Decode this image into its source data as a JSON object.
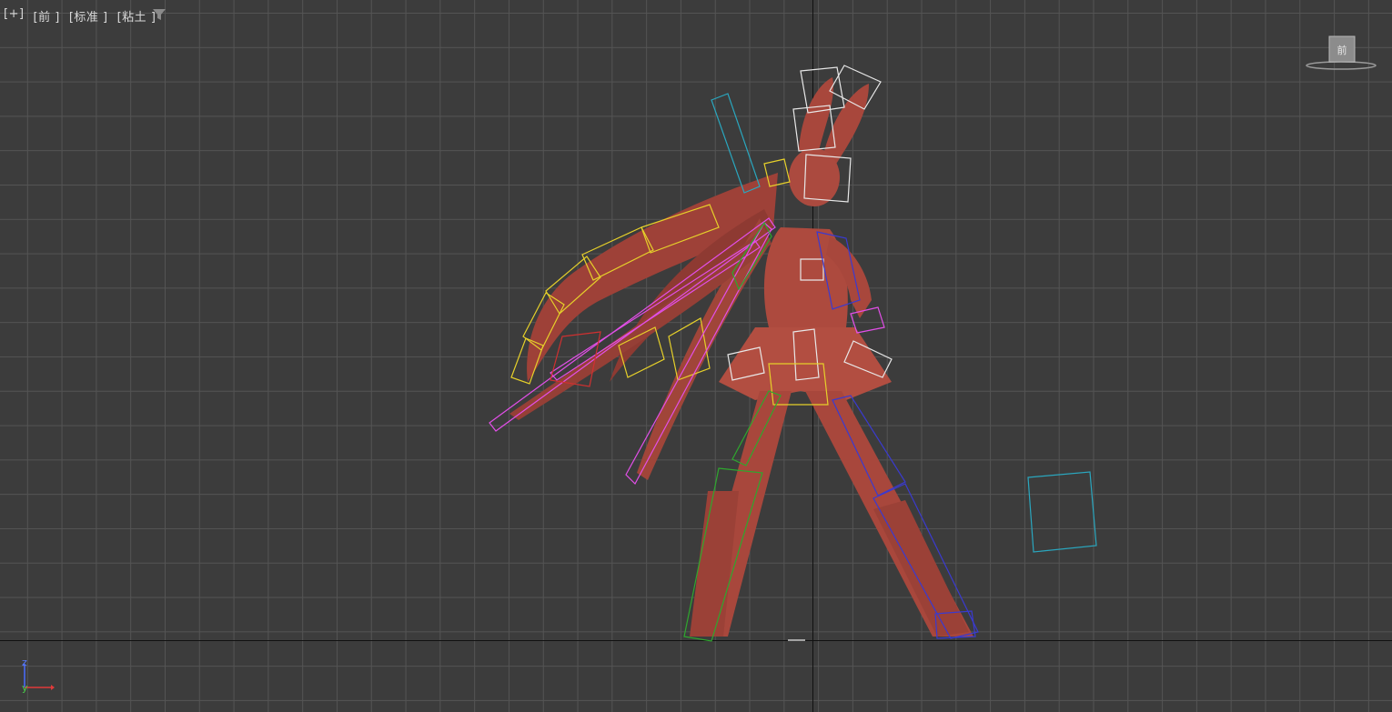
{
  "viewport": {
    "labels": [
      "[+]",
      "[前 ]",
      "[标准 ]",
      "[粘土 ]"
    ],
    "filter_icon": "filter-icon",
    "view_cube_label": "前",
    "tripod": {
      "z": "z",
      "y": "y"
    }
  },
  "colors": {
    "background": "#3c3c3c",
    "grid": "#545454",
    "model": "#a8473c",
    "bone_white": "#e8e8e8",
    "bone_yellow": "#e6d02a",
    "bone_magenta": "#e24fe8",
    "bone_green": "#2ea82e",
    "bone_blue": "#3a3ad0",
    "bone_cyan": "#2aa7bf",
    "bone_red": "#d03030"
  }
}
